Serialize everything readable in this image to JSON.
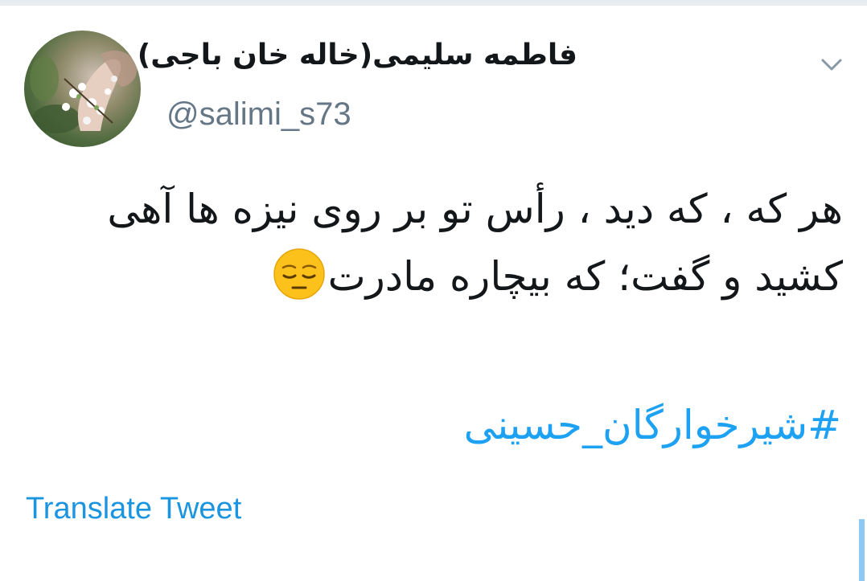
{
  "user": {
    "display_name": "فاطمه سلیمی(خاله خان باجی)",
    "handle": "@salimi_s73",
    "avatar_icon": "avatar-image"
  },
  "tweet": {
    "text_line1": "هر که ، که دید ، رأس تو بر روی نیزه ها آهی",
    "text_line2": "کشید و گفت؛ که بیچاره مادرت",
    "emoji": "pensive-face",
    "hashtag": "#شیرخوارگان_حسینی",
    "translate_label": "Translate Tweet"
  },
  "colors": {
    "link": "#1da1f2",
    "secondary_text": "#657786",
    "primary_text": "#14171a"
  },
  "icons": {
    "menu": "chevron-down-icon"
  }
}
